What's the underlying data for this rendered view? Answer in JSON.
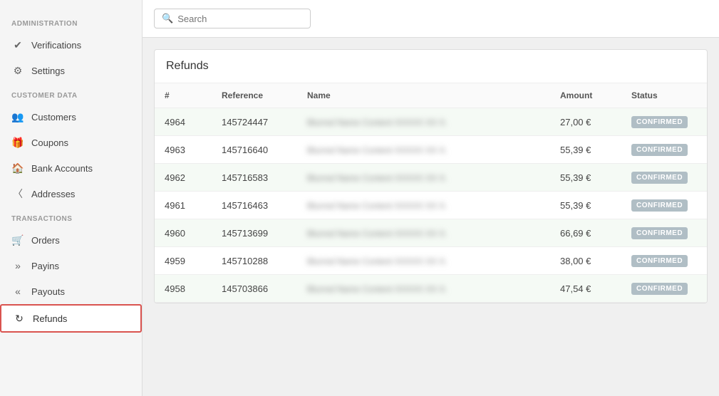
{
  "sidebar": {
    "sections": [
      {
        "label": "ADMINISTRATION",
        "items": [
          {
            "id": "verifications",
            "icon": "✔",
            "label": "Verifications",
            "active": false
          },
          {
            "id": "settings",
            "icon": "⚙",
            "label": "Settings",
            "active": false
          }
        ]
      },
      {
        "label": "CUSTOMER DATA",
        "items": [
          {
            "id": "customers",
            "icon": "👥",
            "label": "Customers",
            "active": false
          },
          {
            "id": "coupons",
            "icon": "🎁",
            "label": "Coupons",
            "active": false
          },
          {
            "id": "bank-accounts",
            "icon": "🏦",
            "label": "Bank Accounts",
            "active": false
          },
          {
            "id": "addresses",
            "icon": "📍",
            "label": "Addresses",
            "active": false
          }
        ]
      },
      {
        "label": "TRANSACTIONS",
        "items": [
          {
            "id": "orders",
            "icon": "🛒",
            "label": "Orders",
            "active": false
          },
          {
            "id": "payins",
            "icon": "»",
            "label": "Payins",
            "active": false
          },
          {
            "id": "payouts",
            "icon": "«",
            "label": "Payouts",
            "active": false
          },
          {
            "id": "refunds",
            "icon": "↺",
            "label": "Refunds",
            "active": true
          }
        ]
      }
    ]
  },
  "search": {
    "placeholder": "Search",
    "value": ""
  },
  "panel": {
    "title": "Refunds",
    "columns": [
      "#",
      "Reference",
      "Name",
      "Amount",
      "Status"
    ],
    "rows": [
      {
        "id": "4964",
        "reference": "145724447",
        "name": "Blurred Name Content XXXXX XX X.",
        "amount": "27,00 €",
        "status": "CONFIRMED"
      },
      {
        "id": "4963",
        "reference": "145716640",
        "name": "Blurred Name Content XXXXX XX X.",
        "amount": "55,39 €",
        "status": "CONFIRMED"
      },
      {
        "id": "4962",
        "reference": "145716583",
        "name": "Blurred Name Content XXXXX XX X.",
        "amount": "55,39 €",
        "status": "CONFIRMED"
      },
      {
        "id": "4961",
        "reference": "145716463",
        "name": "Blurred Name Content XXXXX XX X.",
        "amount": "55,39 €",
        "status": "CONFIRMED"
      },
      {
        "id": "4960",
        "reference": "145713699",
        "name": "Blurred Name Content XXXXX XX X.",
        "amount": "66,69 €",
        "status": "CONFIRMED"
      },
      {
        "id": "4959",
        "reference": "145710288",
        "name": "Blurred Name Content XXXXX XX X.",
        "amount": "38,00 €",
        "status": "CONFIRMED"
      },
      {
        "id": "4958",
        "reference": "145703866",
        "name": "Blurred Name Content XXXXX XX X.",
        "amount": "47,54 €",
        "status": "CONFIRMED"
      }
    ]
  }
}
